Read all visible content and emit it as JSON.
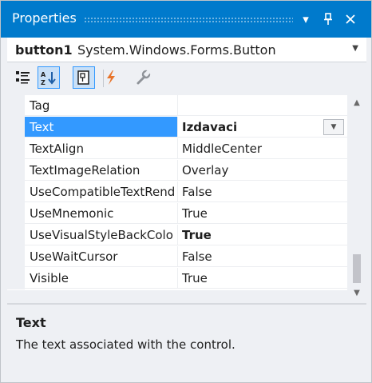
{
  "window": {
    "title": "Properties",
    "dropdown_glyph": "▾",
    "pin_glyph": "⊣",
    "close_glyph": "✕"
  },
  "object_selector": {
    "name": "button1",
    "type": "System.Windows.Forms.Button"
  },
  "toolbar": {
    "buttons": [
      {
        "icon": "categorized-icon",
        "active": false
      },
      {
        "icon": "alphabetical-icon",
        "active": true
      },
      {
        "icon": "properties-icon",
        "active": true
      },
      {
        "icon": "events-lightning-icon",
        "active": false
      },
      {
        "icon": "property-pages-wrench-icon",
        "active": false
      }
    ]
  },
  "grid": {
    "rows": [
      {
        "name": "Tag",
        "value": "",
        "bold_value": false,
        "selected": false
      },
      {
        "name": "Text",
        "value": "Izdavaci",
        "bold_value": true,
        "selected": true
      },
      {
        "name": "TextAlign",
        "value": "MiddleCenter",
        "bold_value": false,
        "selected": false
      },
      {
        "name": "TextImageRelation",
        "value": "Overlay",
        "bold_value": false,
        "selected": false
      },
      {
        "name": "UseCompatibleTextRend",
        "value": "False",
        "bold_value": false,
        "selected": false
      },
      {
        "name": "UseMnemonic",
        "value": "True",
        "bold_value": false,
        "selected": false
      },
      {
        "name": "UseVisualStyleBackColo",
        "value": "True",
        "bold_value": true,
        "selected": false
      },
      {
        "name": "UseWaitCursor",
        "value": "False",
        "bold_value": false,
        "selected": false
      },
      {
        "name": "Visible",
        "value": "True",
        "bold_value": false,
        "selected": false
      }
    ]
  },
  "description": {
    "title": "Text",
    "text": "The text associated with the control."
  },
  "colors": {
    "titlebar": "#007acc",
    "selection": "#3399ff",
    "panel_background": "#eef0f4",
    "events_icon": "#e8742a"
  }
}
